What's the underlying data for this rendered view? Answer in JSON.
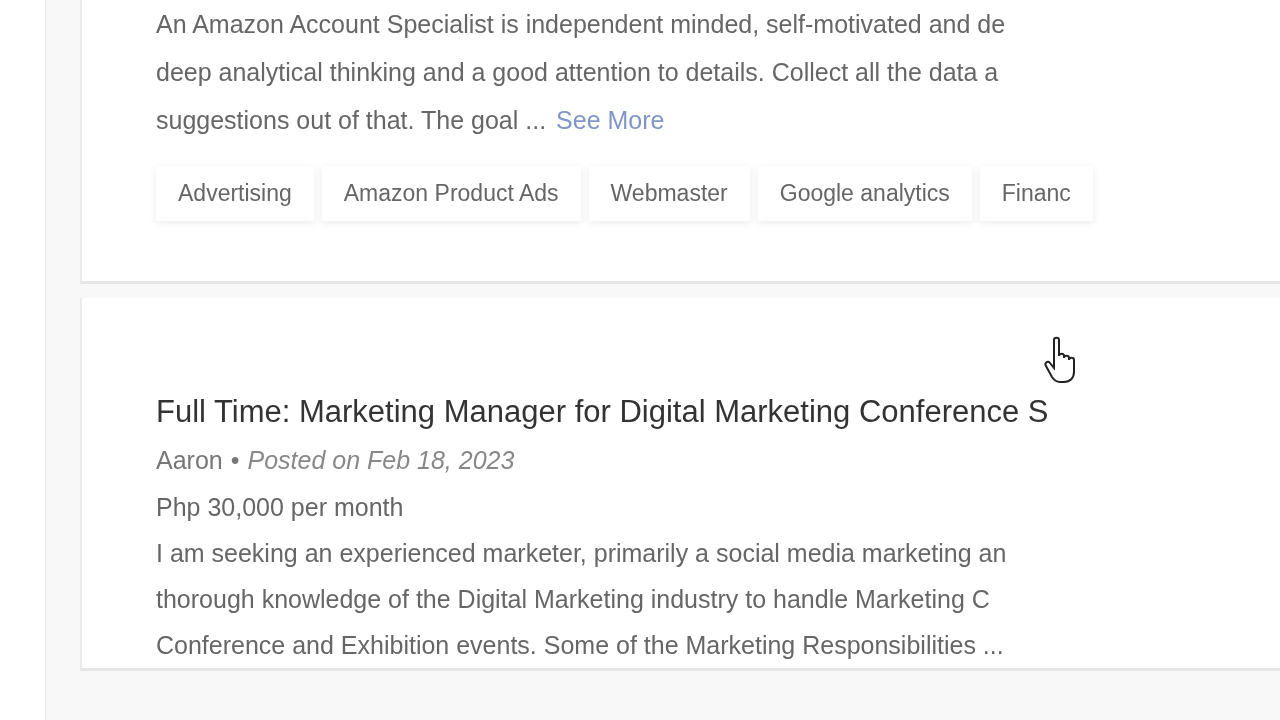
{
  "jobs": [
    {
      "description_lines": [
        "An Amazon Account Specialist is independent minded, self-motivated and de",
        "deep analytical thinking and a good attention to details. Collect all the data a",
        "suggestions out of that. The goal ..."
      ],
      "see_more": "See More",
      "tags": [
        "Advertising",
        "Amazon Product Ads",
        "Webmaster",
        "Google analytics",
        "Financ"
      ]
    },
    {
      "title": "Full Time: Marketing Manager for Digital Marketing Conference S",
      "author": "Aaron",
      "separator": "•",
      "posted": "Posted on Feb 18, 2023",
      "salary": "Php 30,000 per month",
      "description_lines": [
        "I am seeking an experienced marketer, primarily a social media marketing an",
        "thorough knowledge of the Digital Marketing industry to handle Marketing C",
        "Conference and Exhibition events. Some of the Marketing Responsibilities ..."
      ]
    }
  ]
}
